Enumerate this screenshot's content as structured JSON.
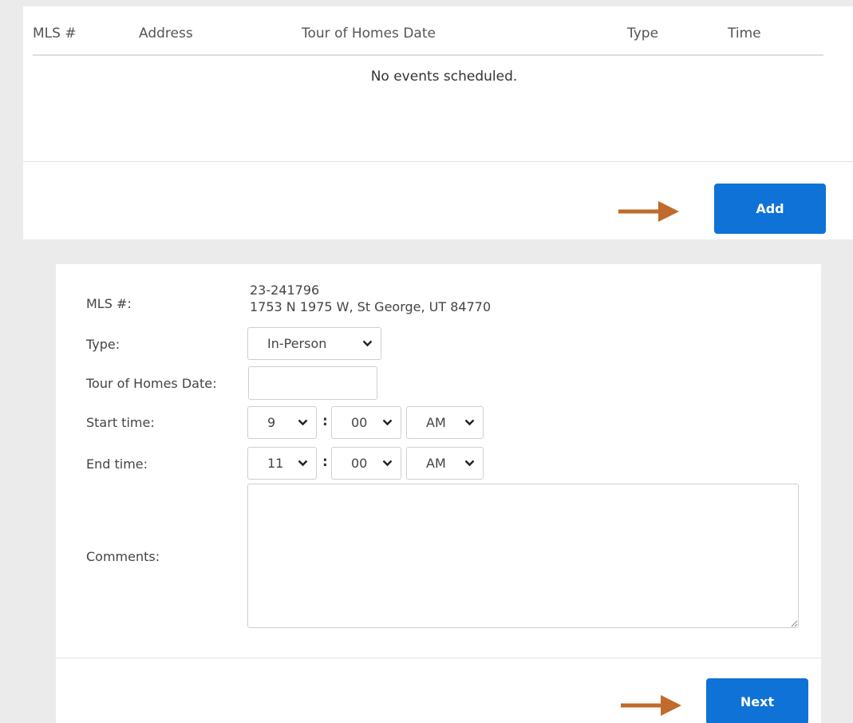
{
  "events_table": {
    "columns": [
      "MLS #",
      "Address",
      "Tour of Homes Date",
      "Type",
      "Time"
    ],
    "empty_message": "No events scheduled."
  },
  "add_button": "Add",
  "form": {
    "mls_label": "MLS #:",
    "mls_number": "23-241796",
    "mls_address": "1753 N 1975 W, St George, UT 84770",
    "type_label": "Type:",
    "type_value": "In-Person",
    "date_label": "Tour of Homes Date:",
    "date_value": "",
    "start_label": "Start time:",
    "start_hour": "9",
    "start_minute": "00",
    "start_ampm": "AM",
    "end_label": "End time:",
    "end_hour": "11",
    "end_minute": "00",
    "end_ampm": "AM",
    "time_separator": ":",
    "comments_label": "Comments:",
    "comments_value": ""
  },
  "next_button": "Next",
  "icons": {
    "select_arrow": "chevron-down-icon",
    "pointer_arrow": "arrow-right-icon",
    "resize": "resize-grip-icon"
  },
  "colors": {
    "primary": "#0f72d6",
    "arrow": "#c06a2b",
    "background": "#ebebeb"
  }
}
